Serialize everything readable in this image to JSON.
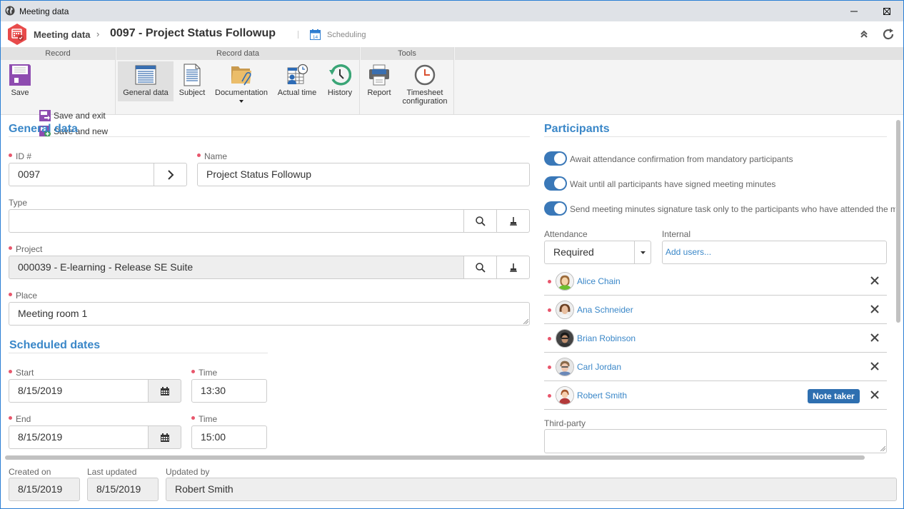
{
  "window": {
    "title": "Meeting data",
    "controls": {
      "minimize": "minimize",
      "maximize": "maximize",
      "close": "close"
    }
  },
  "header": {
    "breadcrumb_root": "Meeting data",
    "breadcrumb_separator": "›",
    "record_title": "0097 - Project Status Followup",
    "calendar_icon_day": "14",
    "module_label": "Scheduling"
  },
  "ribbon": {
    "groups": [
      {
        "title": "Record"
      },
      {
        "title": "Record data"
      },
      {
        "title": "Tools"
      }
    ],
    "save": "Save",
    "save_and_exit": "Save and exit",
    "save_and_new": "Save and new",
    "general_data": "General data",
    "subject": "Subject",
    "documentation": "Documentation",
    "actual_time": "Actual time",
    "history": "History",
    "report": "Report",
    "timesheet_line1": "Timesheet",
    "timesheet_line2": "configuration"
  },
  "general": {
    "section_title": "General data",
    "id_label": "ID #",
    "id_value": "0097",
    "name_label": "Name",
    "name_value": "Project Status Followup",
    "type_label": "Type",
    "type_value": "",
    "project_label": "Project",
    "project_value": "000039 - E-learning - Release SE Suite",
    "place_label": "Place",
    "place_value": "Meeting room 1"
  },
  "scheduled": {
    "section_title": "Scheduled dates",
    "start_label": "Start",
    "start_value": "8/15/2019",
    "start_time_label": "Time",
    "start_time_value": "13:30",
    "end_label": "End",
    "end_value": "8/15/2019",
    "end_time_label": "Time",
    "end_time_value": "15:00"
  },
  "participants": {
    "section_title": "Participants",
    "toggles": [
      {
        "label": "Await attendance confirmation from mandatory participants",
        "on": true
      },
      {
        "label": "Wait until all participants have signed meeting minutes",
        "on": true
      },
      {
        "label": "Send meeting minutes signature task only to the participants who have attended the m",
        "on": true
      }
    ],
    "attendance_label": "Attendance",
    "attendance_value": "Required",
    "internal_label": "Internal",
    "internal_placeholder": "Add users...",
    "list": [
      {
        "name": "Alice Chain",
        "badge": ""
      },
      {
        "name": "Ana Schneider",
        "badge": ""
      },
      {
        "name": "Brian Robinson",
        "badge": ""
      },
      {
        "name": "Carl Jordan",
        "badge": ""
      },
      {
        "name": "Robert Smith",
        "badge": "Note taker"
      }
    ],
    "third_party_label": "Third-party",
    "third_party_value": ""
  },
  "footer": {
    "created_on_label": "Created on",
    "created_on_value": "8/15/2019",
    "last_updated_label": "Last updated",
    "last_updated_value": "8/15/2019",
    "updated_by_label": "Updated by",
    "updated_by_value": "Robert Smith"
  },
  "colors": {
    "accent": "#3a87c8",
    "toggle_on": "#3a78b8",
    "required_dot": "#e8566c",
    "badge": "#2e6fb0",
    "app_logo": "#e84b4b"
  }
}
